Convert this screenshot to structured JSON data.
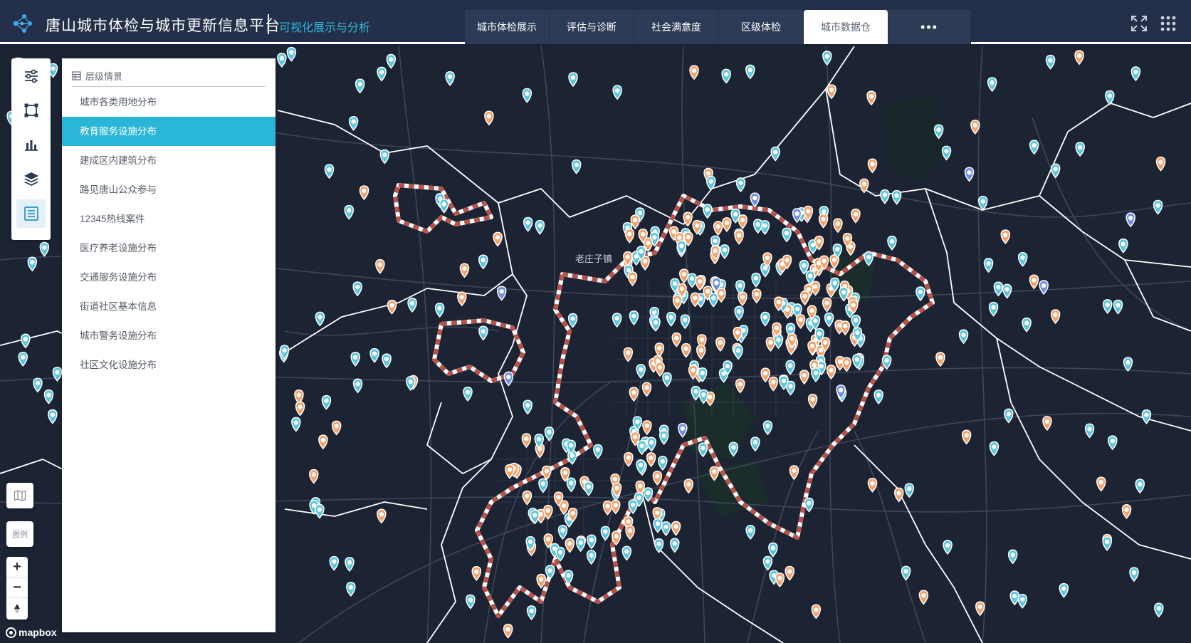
{
  "header": {
    "title": "唐山城市体检与城市更新信息平台",
    "subtitle": "可视化展示与分析",
    "tabs": [
      {
        "label": "城市体检展示"
      },
      {
        "label": "评估与诊断"
      },
      {
        "label": "社会满意度"
      },
      {
        "label": "区级体检"
      },
      {
        "label": "城市数据仓"
      },
      {
        "label": "•••"
      }
    ],
    "active_tab": "城市数据仓",
    "icons": [
      "fullscreen-icon",
      "app-grid-icon"
    ],
    "colors": {
      "background": "#243049",
      "tab": "#2e3b57",
      "subtitle": "#2fb8d9"
    }
  },
  "toolbar": {
    "tools": [
      "settings-sliders-icon",
      "draw-area-icon",
      "bar-chart-icon",
      "layers-icon",
      "list-icon"
    ],
    "active_tool": "list-icon"
  },
  "panel": {
    "title": "层级情景",
    "items": [
      {
        "label": "城市各类用地分布"
      },
      {
        "label": "教育服务设施分布"
      },
      {
        "label": "建成区内建筑分布"
      },
      {
        "label": "路见唐山公众参与"
      },
      {
        "label": "12345热线案件"
      },
      {
        "label": "医疗养老设施分布"
      },
      {
        "label": "交通服务设施分布"
      },
      {
        "label": "街道社区基本信息"
      },
      {
        "label": "城市警务设施分布"
      },
      {
        "label": "社区文化设施分布"
      }
    ],
    "active_item": "教育服务设施分布",
    "accent": "#2ab6d6"
  },
  "map": {
    "town_label": "老庄子镇",
    "legend_label": "图例",
    "zoom_in": "+",
    "zoom_out": "−",
    "attribution": "mapbox",
    "marker_colors": {
      "school": "#5cc6dd",
      "kindergarten": "#f3a26a",
      "university": "#6f8ee6"
    },
    "boundary_color": "#b8534c"
  }
}
